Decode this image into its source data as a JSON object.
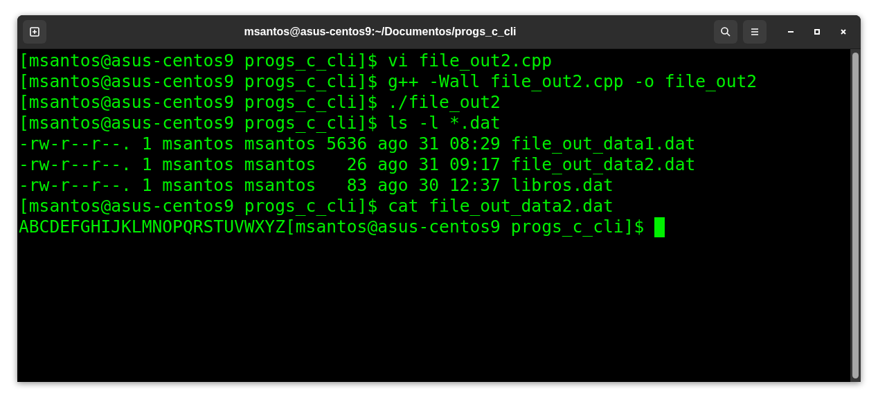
{
  "window": {
    "title": "msantos@asus-centos9:~/Documentos/progs_c_cli"
  },
  "terminal": {
    "lines": [
      {
        "text": "[msantos@asus-centos9 progs_c_cli]$ vi file_out2.cpp",
        "cursor": false
      },
      {
        "text": "[msantos@asus-centos9 progs_c_cli]$ g++ -Wall file_out2.cpp -o file_out2",
        "cursor": false
      },
      {
        "text": "[msantos@asus-centos9 progs_c_cli]$ ./file_out2",
        "cursor": false
      },
      {
        "text": "[msantos@asus-centos9 progs_c_cli]$ ls -l *.dat",
        "cursor": false
      },
      {
        "text": "-rw-r--r--. 1 msantos msantos 5636 ago 31 08:29 file_out_data1.dat",
        "cursor": false
      },
      {
        "text": "-rw-r--r--. 1 msantos msantos   26 ago 31 09:17 file_out_data2.dat",
        "cursor": false
      },
      {
        "text": "-rw-r--r--. 1 msantos msantos   83 ago 30 12:37 libros.dat",
        "cursor": false
      },
      {
        "text": "[msantos@asus-centos9 progs_c_cli]$ cat file_out_data2.dat",
        "cursor": false
      },
      {
        "text": "ABCDEFGHIJKLMNOPQRSTUVWXYZ[msantos@asus-centos9 progs_c_cli]$ ",
        "cursor": true
      }
    ]
  }
}
